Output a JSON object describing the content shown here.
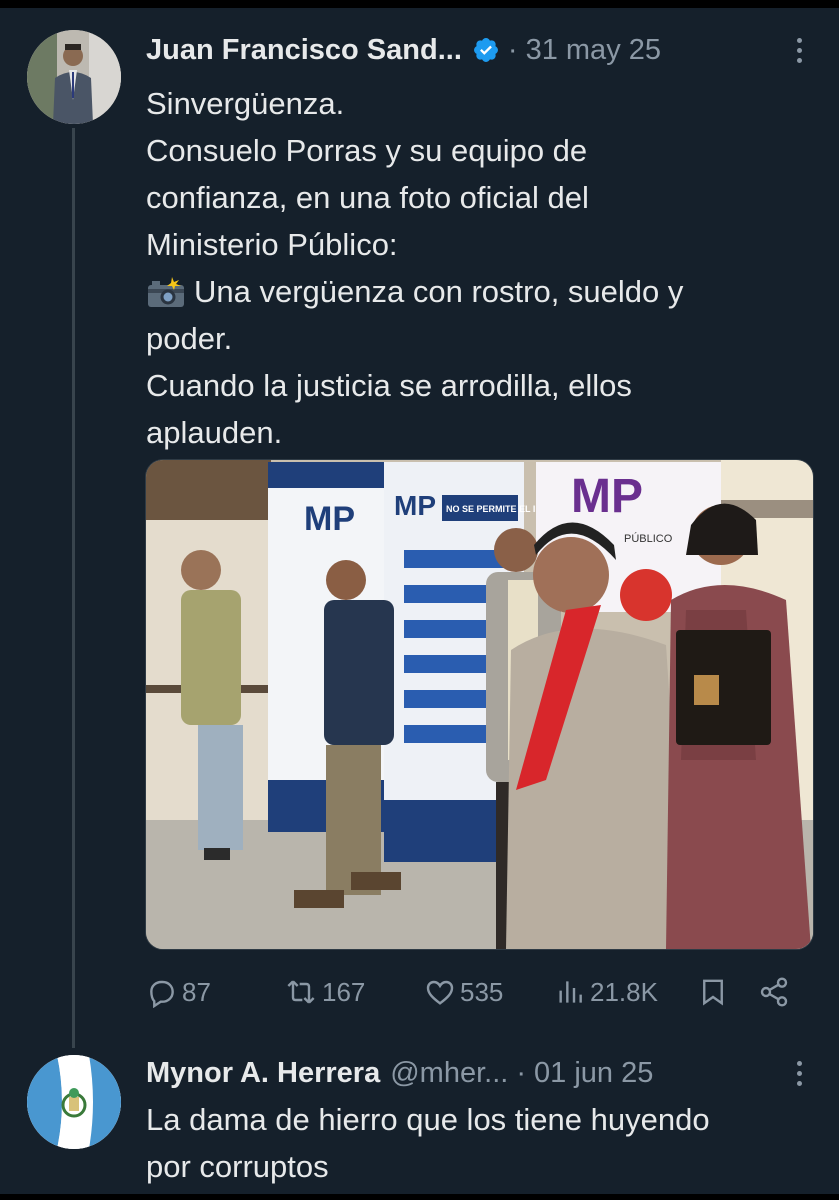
{
  "tweet": {
    "author_name": "Juan Francisco Sand...",
    "verified": true,
    "date": "· 31 may 25",
    "text_lines": [
      "Sinvergüenza.",
      "Consuelo Porras y su equipo de",
      "confianza, en una foto oficial del",
      "Ministerio Público:",
      "Una vergüenza con rostro, sueldo y",
      "poder.",
      "Cuando la justicia se arrodilla, ellos",
      "aplauden."
    ],
    "emoji_icon": "camera-with-flash-icon",
    "media": {
      "banner_mp_left": "MP",
      "banner_mp_middle": "MP",
      "banner_mp_right": "MP",
      "banner_notice": "NO SE PERMITE EL INGRESO",
      "banner_sub": "PÚBLICO"
    },
    "stats": {
      "replies": "87",
      "reposts": "167",
      "likes": "535",
      "views": "21.8K"
    }
  },
  "reply": {
    "author_name": "Mynor A. Herrera",
    "handle": "@mher...",
    "date": "· 01 jun 25",
    "text_lines": [
      "La dama de hierro que los tiene huyendo",
      "por corruptos"
    ]
  },
  "colors": {
    "background": "#15202b",
    "text": "#e7e9ea",
    "muted": "#8b98a5",
    "verified_blue": "#1d9bf0"
  }
}
